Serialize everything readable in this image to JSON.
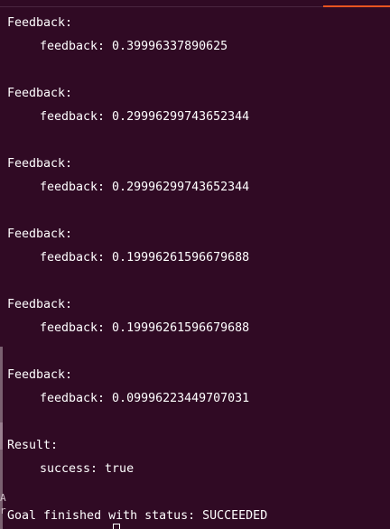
{
  "terminal": {
    "output": [
      {
        "header": "Feedback:",
        "line": "feedback: 0.39996337890625"
      },
      {
        "header": "Feedback:",
        "line": "feedback: 0.29996299743652344"
      },
      {
        "header": "Feedback:",
        "line": "feedback: 0.29996299743652344"
      },
      {
        "header": "Feedback:",
        "line": "feedback: 0.19996261596679688"
      },
      {
        "header": "Feedback:",
        "line": "feedback: 0.19996261596679688"
      },
      {
        "header": "Feedback:",
        "line": "feedback: 0.09996223449707031"
      },
      {
        "header": "Result:",
        "line": "success: true"
      }
    ],
    "status": "Goal finished with status: SUCCEEDED",
    "edge_glyphs": [
      "A",
      "r"
    ]
  },
  "colors": {
    "background": "#300a24",
    "text": "#ffffff",
    "accent": "#e95420"
  }
}
